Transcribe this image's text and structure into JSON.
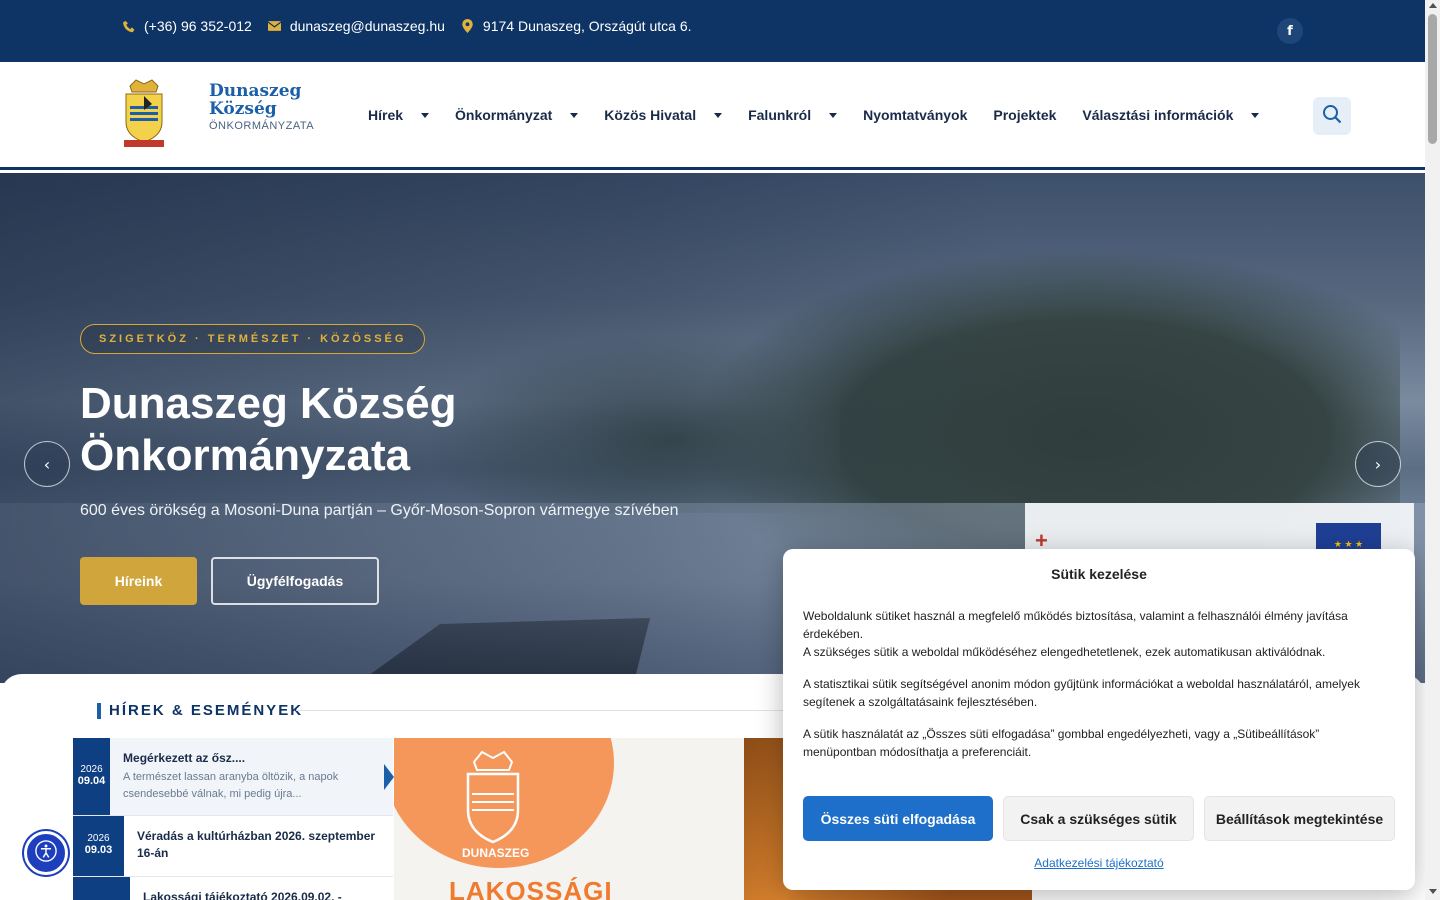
{
  "topbar": {
    "phone": "(+36) 96 352-012",
    "email": "dunaszeg@dunaszeg.hu",
    "address": "9174 Dunaszeg, Országút utca 6.",
    "icons": [
      "phone-icon",
      "envelope-icon",
      "map-pin-icon",
      "facebook-icon"
    ]
  },
  "brand": {
    "line1": "Dunaszeg",
    "line2": "Község",
    "line3": "ÖNKORMÁNYZATA",
    "logo_text": "DUNASZEG"
  },
  "nav": {
    "items": [
      {
        "label": "Hírek",
        "dropdown": true
      },
      {
        "label": "Önkormányzat",
        "dropdown": true
      },
      {
        "label": "Közös Hivatal",
        "dropdown": true
      },
      {
        "label": "Falunkról",
        "dropdown": true
      },
      {
        "label": "Nyomtatványok",
        "dropdown": false
      },
      {
        "label": "Projektek",
        "dropdown": false
      },
      {
        "label": "Választási információk",
        "dropdown": true
      }
    ]
  },
  "hero": {
    "tagline": "SZIGETKÖZ · TERMÉSZET · KÖZÖSSÉG",
    "title": "Dunaszeg Község Önkormányzata",
    "subtitle": "600 éves örökség a Mosoni-Duna partján – Győr-Moson-Sopron vármegye szívében",
    "button_primary": "Híreink",
    "button_secondary": "Ügyfélfogadás",
    "prev": "‹",
    "next": "›"
  },
  "news": {
    "heading": "HÍREK & ESEMÉNYEK",
    "items": [
      {
        "year": "2026",
        "date": "09.04",
        "title": "Megérkezett az ősz....",
        "excerpt": "A természet lassan aranyba öltözik, a napok csendesebbé válnak, mi pedig újra..."
      },
      {
        "year": "2026",
        "date": "09.03",
        "title": "Véradás a kultúrházban 2026. szeptember 16-án",
        "excerpt": ""
      },
      {
        "year": "",
        "date": "",
        "title": "Lakossági tájékoztató 2026.09.02. -",
        "excerpt": ""
      }
    ],
    "card_brand": "DUNASZEG",
    "card_title": "LAKOSSÁGI"
  },
  "cookie": {
    "title": "Sütik kezelése",
    "p1": "Weboldalunk sütiket használ a megfelelő működés biztosítása, valamint a felhasználói élmény javítása érdekében.",
    "p1b": "A szükséges sütik a weboldal működéséhez elengedhetetlenek, ezek automatikusan aktiválódnak.",
    "p2": "A statisztikai sütik segítségével anonim módon gyűjtünk információkat a weboldal használatáról, amelyek segítenek a szolgáltatásaink fejlesztésében.",
    "p3": "A sütik használatát az „Összes süti elfogadása” gombbal engedélyezheti, vagy a „Sütibeállítások” menüpontban módosíthatja a preferenciáit.",
    "btn_accept": "Összes süti elfogadása",
    "btn_necessary": "Csak a szükséges sütik",
    "btn_settings": "Beállítások megtekintése",
    "policy": "Adatkezelési tájékoztató"
  },
  "colors": {
    "navy": "#0e3466",
    "gold": "#d0a53c",
    "accent_blue": "#1e6fc9"
  }
}
